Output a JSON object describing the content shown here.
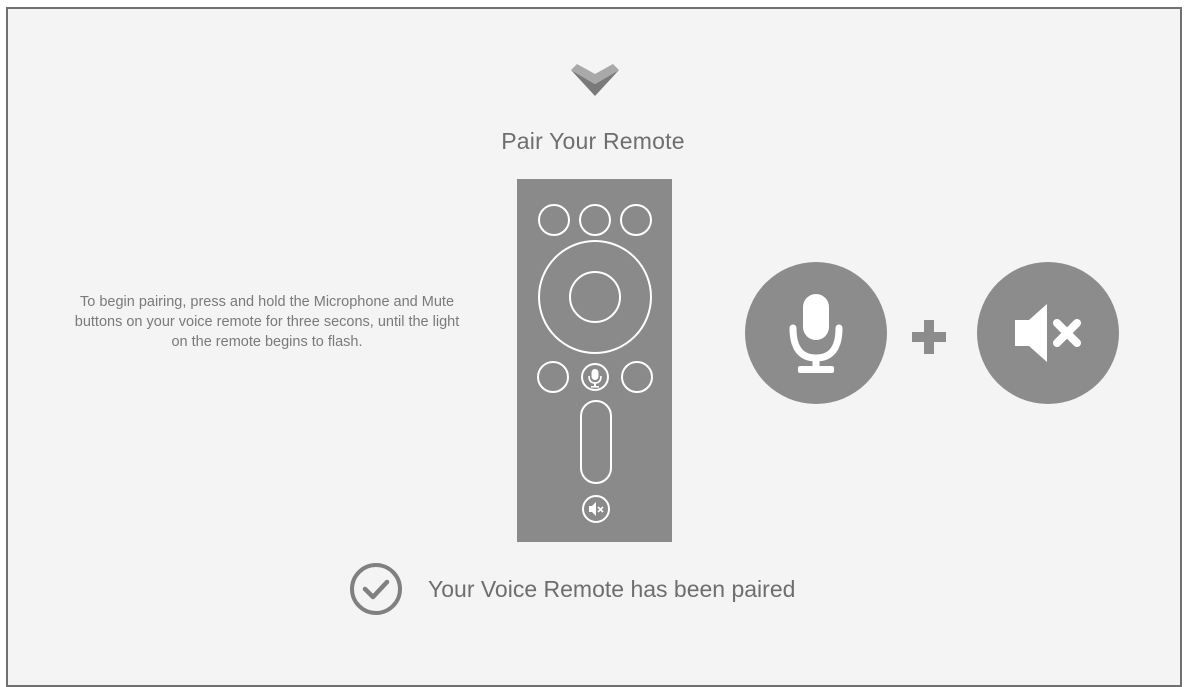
{
  "screen": {
    "title": "Pair Your Remote",
    "instructions": "To begin pairing, press and hold the Microphone and Mute buttons on your voice remote for three secons, until the light on the remote begins to flash.",
    "status_text": "Your Voice Remote has been paired"
  },
  "icons": {
    "logo": "vizio-chevron-logo",
    "remote": "voice-remote-illustration",
    "microphone": "microphone-icon",
    "mute": "mute-icon",
    "plus": "plus-icon",
    "status": "check-circle-icon"
  },
  "colors": {
    "background": "#f4f4f4",
    "remote": "#8a8a8a",
    "icon_circle": "#8c8c8c",
    "text": "#6e6e6e"
  }
}
